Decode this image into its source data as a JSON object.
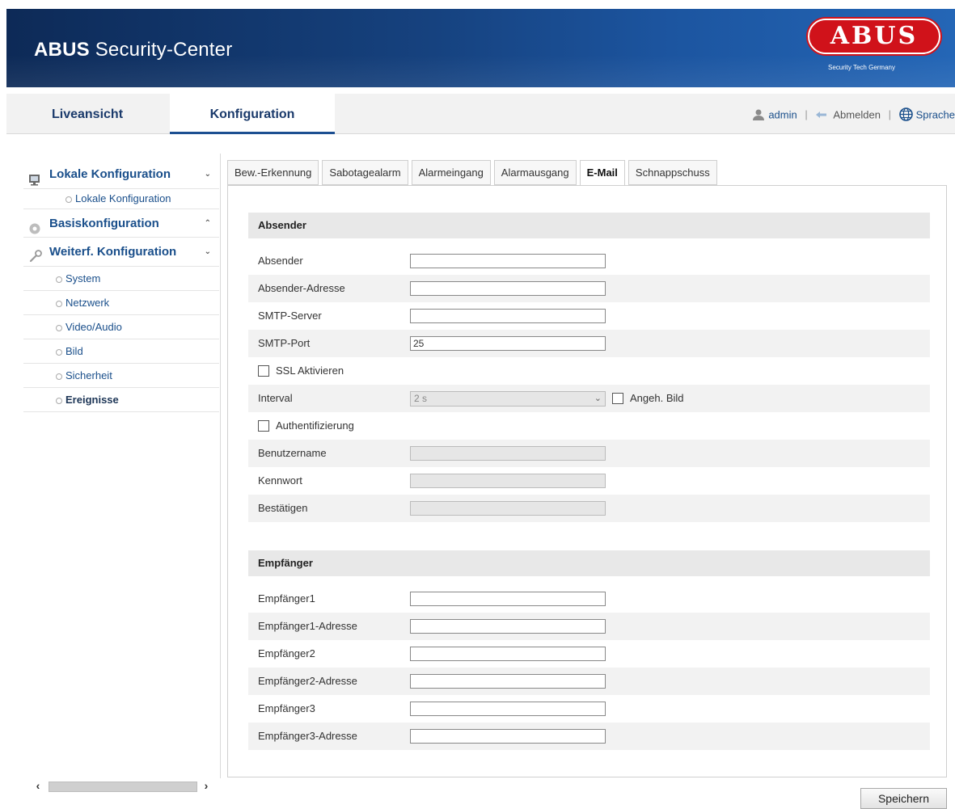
{
  "header": {
    "brand_bold": "ABUS",
    "brand_rest": "Security-Center",
    "logo_text": "ABUS",
    "logo_tagline": "Security Tech Germany"
  },
  "topnav": {
    "tabs": [
      {
        "label": "Liveansicht"
      },
      {
        "label": "Konfiguration"
      }
    ],
    "user": "admin",
    "logout": "Abmelden",
    "language": "Sprache"
  },
  "sidebar": {
    "local": {
      "label": "Lokale Konfiguration",
      "items": [
        {
          "label": "Lokale Konfiguration"
        }
      ]
    },
    "basic": {
      "label": "Basiskonfiguration"
    },
    "advanced": {
      "label": "Weiterf. Konfiguration",
      "items": [
        {
          "label": "System"
        },
        {
          "label": "Netzwerk"
        },
        {
          "label": "Video/Audio"
        },
        {
          "label": "Bild"
        },
        {
          "label": "Sicherheit"
        },
        {
          "label": "Ereignisse"
        }
      ]
    }
  },
  "tabs": [
    {
      "label": "Bew.-Erkennung"
    },
    {
      "label": "Sabotagealarm"
    },
    {
      "label": "Alarmeingang"
    },
    {
      "label": "Alarmausgang"
    },
    {
      "label": "E-Mail"
    },
    {
      "label": "Schnappschuss"
    }
  ],
  "sender_section": {
    "title": "Absender",
    "sender_label": "Absender",
    "sender_value": "",
    "address_label": "Absender-Adresse",
    "address_value": "",
    "smtp_server_label": "SMTP-Server",
    "smtp_server_value": "",
    "smtp_port_label": "SMTP-Port",
    "smtp_port_value": "25",
    "ssl_label": "SSL Aktivieren",
    "interval_label": "Interval",
    "interval_value": "2 s",
    "attach_label": "Angeh. Bild",
    "auth_label": "Authentifizierung",
    "username_label": "Benutzername",
    "password_label": "Kennwort",
    "confirm_label": "Bestätigen"
  },
  "receiver_section": {
    "title": "Empfänger",
    "rows": [
      {
        "label": "Empfänger1",
        "value": ""
      },
      {
        "label": "Empfänger1-Adresse",
        "value": ""
      },
      {
        "label": "Empfänger2",
        "value": ""
      },
      {
        "label": "Empfänger2-Adresse",
        "value": ""
      },
      {
        "label": "Empfänger3",
        "value": ""
      },
      {
        "label": "Empfänger3-Adresse",
        "value": ""
      }
    ]
  },
  "save_label": "Speichern"
}
